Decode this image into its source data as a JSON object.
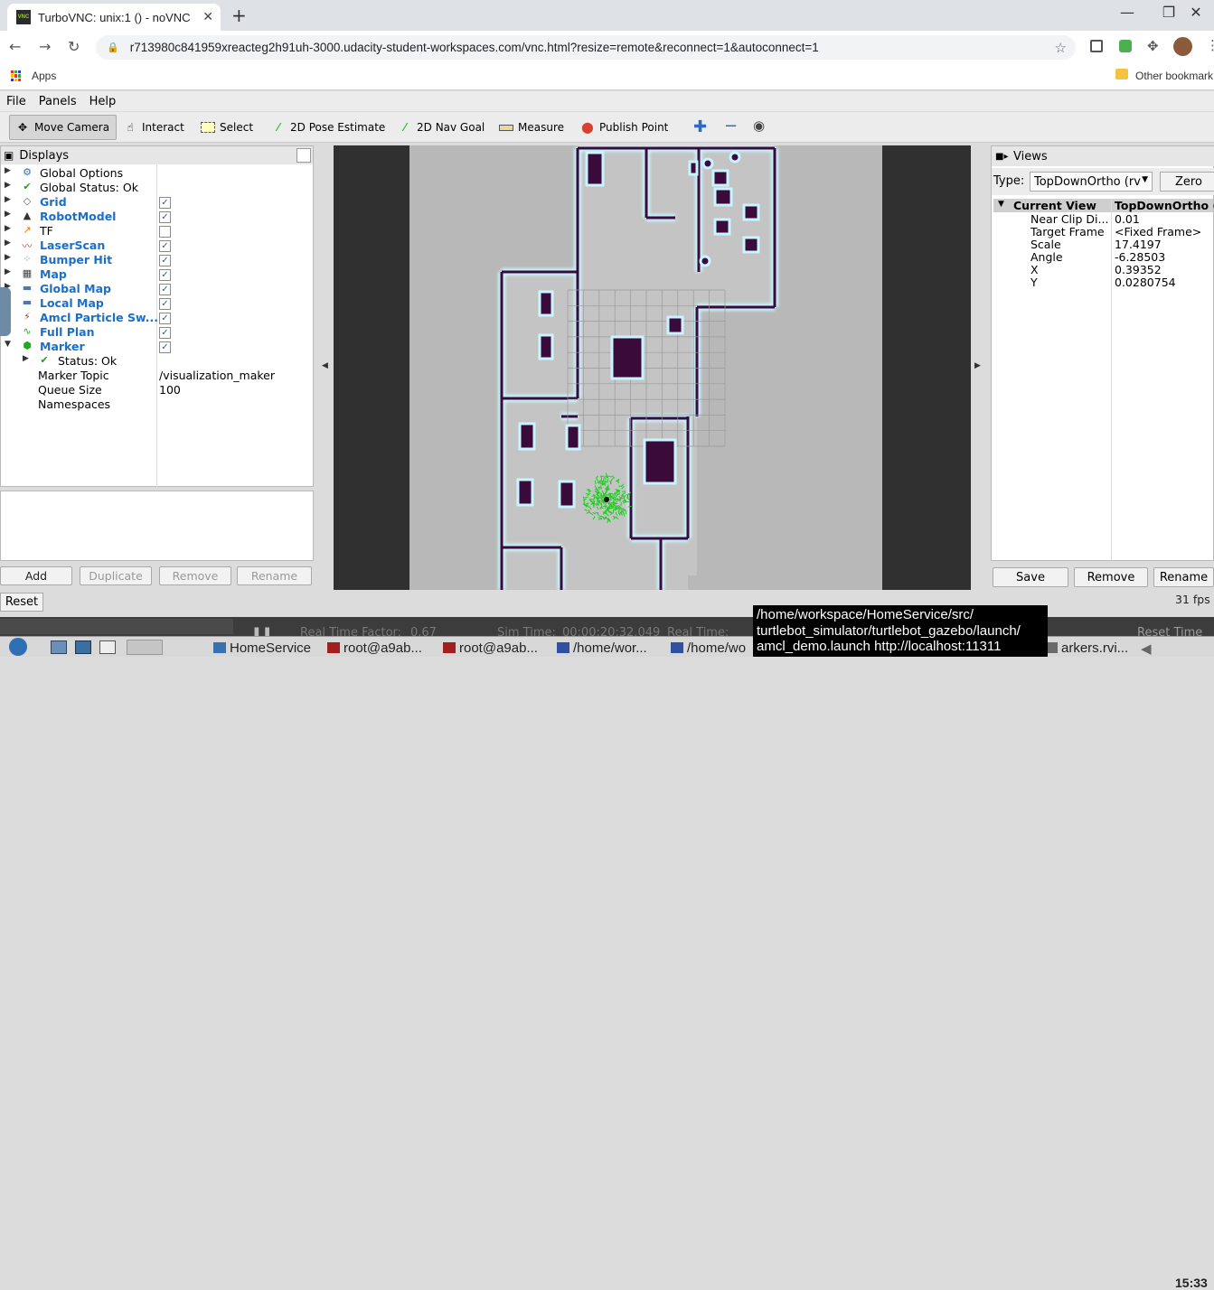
{
  "browser": {
    "tab_title": "TurboVNC: unix:1 () - noVNC",
    "tab_icon_text": "VNC",
    "url": "r713980c841959xreacteg2h91uh-3000.udacity-student-workspaces.com/vnc.html?resize=remote&reconnect=1&autoconnect=1",
    "bookmarks": {
      "apps_label": "Apps",
      "other_label": "Other bookmark"
    }
  },
  "menubar": {
    "file": "File",
    "panels": "Panels",
    "help": "Help"
  },
  "toolbar": {
    "move_camera": "Move Camera",
    "interact": "Interact",
    "select": "Select",
    "pose_estimate": "2D Pose Estimate",
    "nav_goal": "2D Nav Goal",
    "measure": "Measure",
    "publish_point": "Publish Point"
  },
  "displays": {
    "title": "Displays",
    "items": [
      {
        "label": "Global Options",
        "style": "plain",
        "checked": null,
        "expand": "right"
      },
      {
        "label": "Global Status: Ok",
        "style": "plain",
        "checked": null,
        "expand": "right"
      },
      {
        "label": "Grid",
        "style": "blue",
        "checked": true,
        "expand": "right"
      },
      {
        "label": "RobotModel",
        "style": "blue",
        "checked": true,
        "expand": "right"
      },
      {
        "label": "TF",
        "style": "plain",
        "checked": false,
        "expand": "right"
      },
      {
        "label": "LaserScan",
        "style": "blue",
        "checked": true,
        "expand": "right"
      },
      {
        "label": "Bumper Hit",
        "style": "blue",
        "checked": true,
        "expand": "right"
      },
      {
        "label": "Map",
        "style": "blue",
        "checked": true,
        "expand": "right"
      },
      {
        "label": "Global Map",
        "style": "blue",
        "checked": true,
        "expand": "right"
      },
      {
        "label": "Local Map",
        "style": "blue",
        "checked": true,
        "expand": "right"
      },
      {
        "label": "Amcl Particle Sw...",
        "style": "blue",
        "checked": true,
        "expand": "right"
      },
      {
        "label": "Full Plan",
        "style": "blue",
        "checked": true,
        "expand": "right"
      },
      {
        "label": "Marker",
        "style": "blue",
        "checked": true,
        "expand": "down"
      }
    ],
    "marker_props": [
      {
        "key": "Status: Ok",
        "value": ""
      },
      {
        "key": "Marker Topic",
        "value": "/visualization_maker"
      },
      {
        "key": "Queue Size",
        "value": "100"
      },
      {
        "key": "Namespaces",
        "value": ""
      }
    ],
    "buttons": {
      "add": "Add",
      "duplicate": "Duplicate",
      "remove": "Remove",
      "rename": "Rename"
    },
    "reset": "Reset"
  },
  "views": {
    "title": "Views",
    "type_label": "Type:",
    "type_value": "TopDownOrtho (rv",
    "zero_button": "Zero",
    "header_key": "Current View",
    "header_value": "TopDownOrtho (",
    "props": [
      {
        "key": "Near Clip Di...",
        "value": "0.01"
      },
      {
        "key": "Target Frame",
        "value": "<Fixed Frame>"
      },
      {
        "key": "Scale",
        "value": "17.4197"
      },
      {
        "key": "Angle",
        "value": "-6.28503"
      },
      {
        "key": "X",
        "value": "0.39352"
      },
      {
        "key": "Y",
        "value": "0.0280754"
      }
    ],
    "buttons": {
      "save": "Save",
      "remove": "Remove",
      "rename": "Rename"
    },
    "fps": "31 fps"
  },
  "timebar": {
    "real_time_factor_label": "Real Time Factor:",
    "real_time_factor_value": "0.67",
    "sim_time_label": "Sim Time:",
    "sim_time_value": "00:00:20:32.049",
    "real_time_label": "Real Time:",
    "reset_time": "Reset Time"
  },
  "taskbar": {
    "items": [
      "HomeService",
      "root@a9ab...",
      "root@a9ab...",
      "/home/wor...",
      "/home/wo",
      "arkers.rvi..."
    ],
    "clock": "15:33"
  },
  "tooltip": {
    "lines": [
      "/home/workspace/HomeService/src/",
      "turtlebot_simulator/turtlebot_gazebo/launch/",
      "amcl_demo.launch http://localhost:11311"
    ]
  },
  "colors": {
    "link_blue": "#1a6fc9",
    "obstacle": "#3a0a3a",
    "halo": "#bfefff",
    "particles": "#22cc22"
  }
}
